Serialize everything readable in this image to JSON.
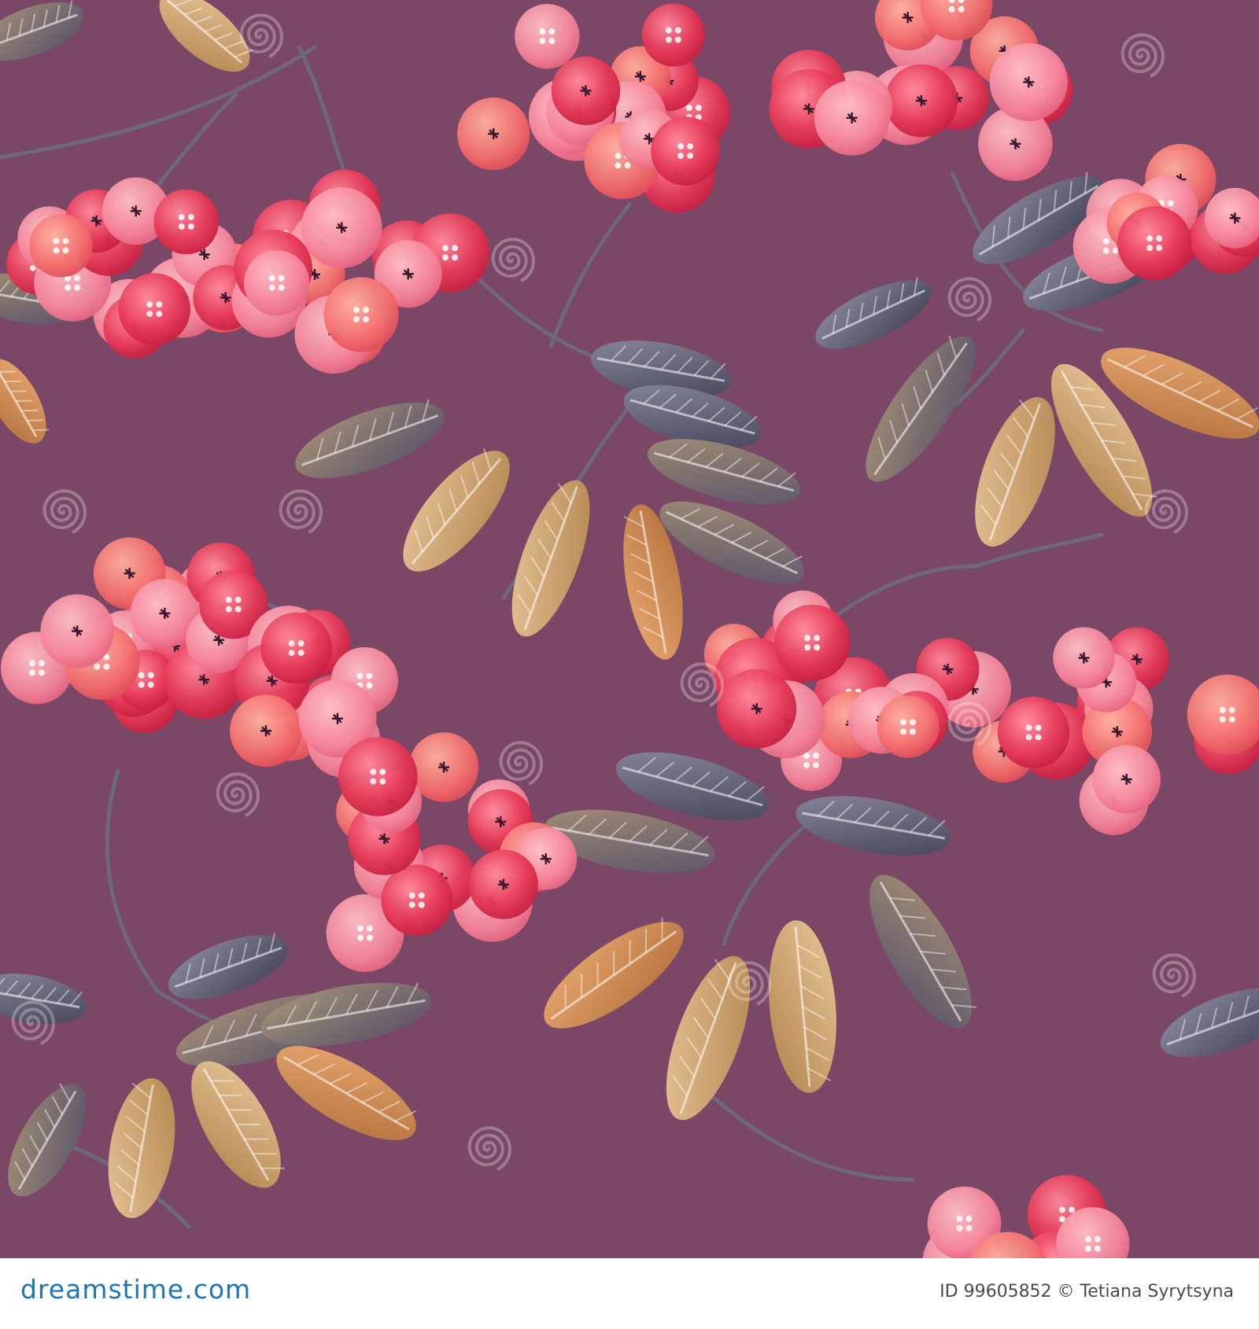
{
  "image": {
    "subject": "watercolor seamless pattern of rowan berries and leaves",
    "background_color": "#7a4766",
    "berry_colors": [
      "#e0234a",
      "#f06a7a",
      "#f59aa8",
      "#e8545e"
    ],
    "leaf_colors": [
      "#585a6c",
      "#8a7c62",
      "#c99a5a",
      "#d9b27c"
    ],
    "stem_color": "#6c6c7e",
    "watermark": {
      "text": "dreamstime",
      "glyph": "spiral-icon"
    }
  },
  "footer": {
    "logo": "dreamstime.com",
    "credit": "ID 99605852 © Tetiana Syrytsyna"
  }
}
